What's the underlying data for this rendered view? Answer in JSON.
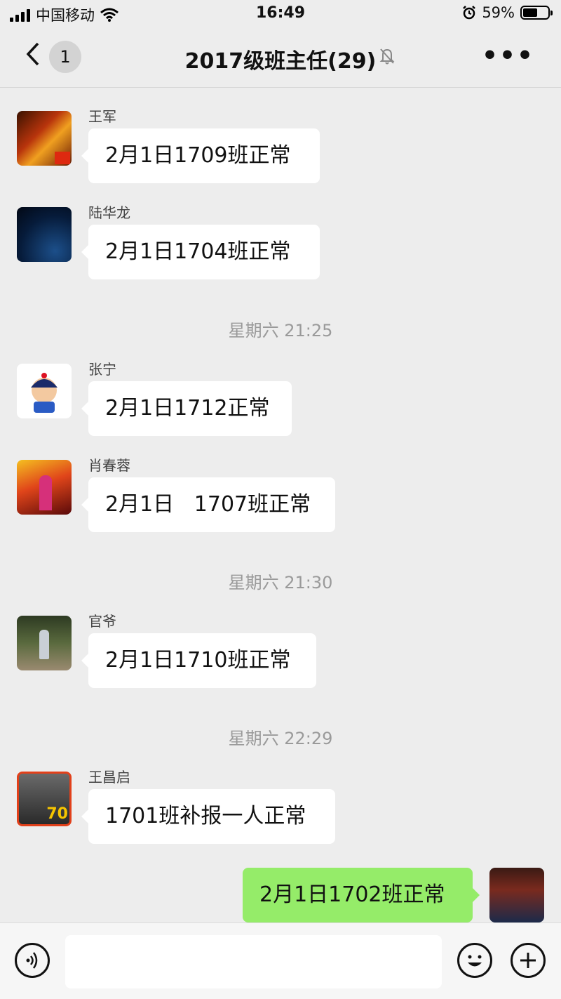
{
  "status_bar": {
    "carrier": "中国移动",
    "time": "16:49",
    "battery": "59%",
    "battery_level": 0.59
  },
  "nav": {
    "back_count": "1",
    "title": "2017级班主任(29)",
    "muted": true
  },
  "messages": [
    {
      "sender": "王军",
      "text": "2月1日1709班正常"
    },
    {
      "sender": "陆华龙",
      "text": "2月1日1704班正常"
    },
    {
      "timestamp": "星期六 21:25"
    },
    {
      "sender": "张宁",
      "text": "2月1日1712正常"
    },
    {
      "sender": "肖春蓉",
      "text": "2月1日   1707班正常"
    },
    {
      "timestamp": "星期六 21:30"
    },
    {
      "sender": "官爷",
      "text": "2月1日1710班正常"
    },
    {
      "timestamp": "星期六 22:29"
    },
    {
      "sender": "王昌启",
      "text": "1701班补报一人正常"
    },
    {
      "sender": "me",
      "text": "2月1日1702班正常"
    }
  ],
  "colors": {
    "background": "#ededed",
    "own_bubble": "#95ec69",
    "other_bubble": "#ffffff"
  },
  "input": {
    "value": ""
  }
}
